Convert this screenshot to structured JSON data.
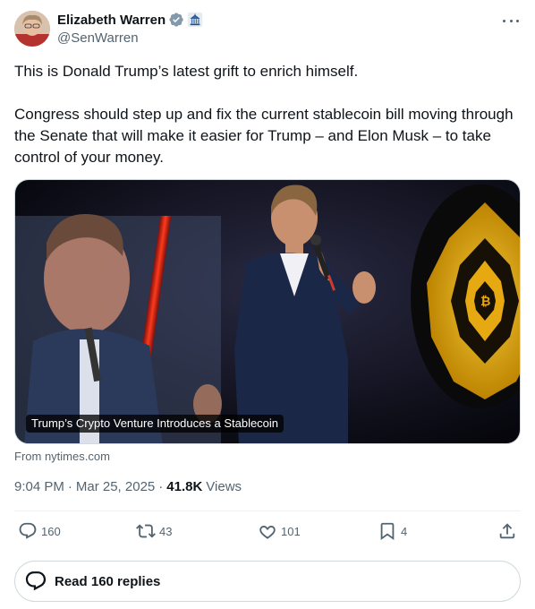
{
  "author": {
    "display_name": "Elizabeth Warren",
    "handle": "@SenWarren",
    "verified_icon": "verified-badge-icon",
    "affiliation_icon": "government-badge-icon"
  },
  "tweet": {
    "paragraphs": [
      "This is Donald Trump’s latest grift to enrich himself.",
      "Congress should step up and fix the current stablecoin bill moving through the Senate that will make it easier for Trump – and Elon Musk – to take control of your money."
    ]
  },
  "card": {
    "caption": "Trump’s Crypto Venture Introduces a Stablecoin",
    "source": "From nytimes.com"
  },
  "meta": {
    "time": "9:04 PM",
    "date": "Mar 25, 2025",
    "views_count": "41.8K",
    "views_label": "Views"
  },
  "actions": {
    "replies": "160",
    "reposts": "43",
    "likes": "101",
    "bookmarks": "4"
  },
  "read_replies_label": "Read 160 replies",
  "colors": {
    "text_primary": "#0f1419",
    "text_secondary": "#536471",
    "verified_blue": "#1d9bf0",
    "gov_badge": "#829aab",
    "border": "#cfd9de"
  }
}
